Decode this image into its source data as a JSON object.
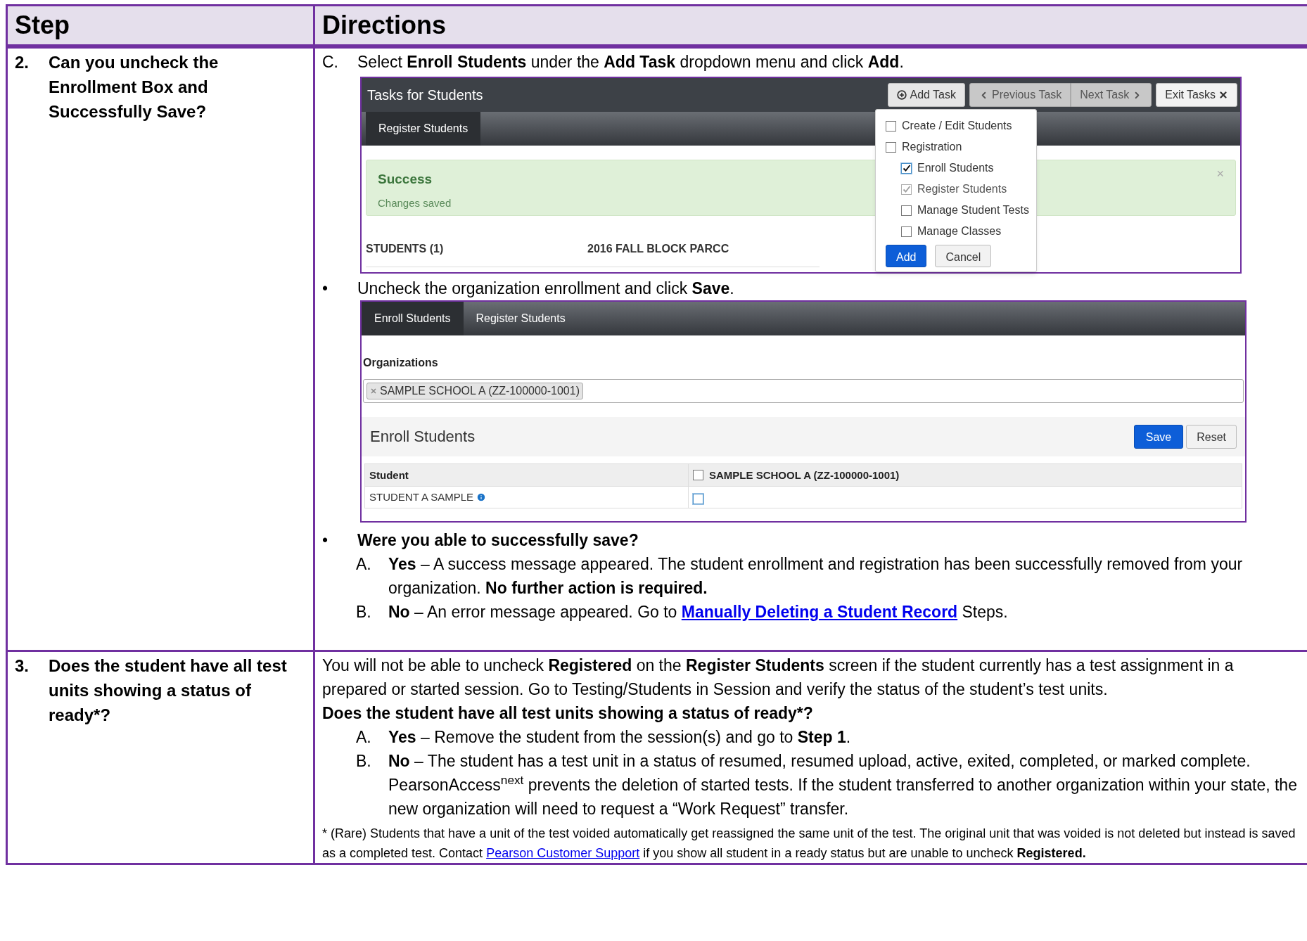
{
  "table": {
    "columns": [
      "Step",
      "Directions"
    ],
    "rows": [
      {
        "number": "2.",
        "question": "Can you uncheck the Enrollment Box and Successfully Save?",
        "directions": [
          {
            "kind": "lettered",
            "marker": "C.",
            "text": "Select **Enroll Students** under the **Add Task** dropdown menu and click **Add**."
          },
          {
            "kind": "tasks_screenshot",
            "title": "Tasks for Students",
            "add_task": "Add Task",
            "previous_task": "Previous Task",
            "next_task": "Next Task",
            "exit_tasks": "Exit Tasks",
            "tab": "Register Students",
            "alert_title": "Success",
            "alert_message": "Changes saved",
            "alert_close": "×",
            "column_1": "STUDENTS (1)",
            "column_2": "2016 FALL BLOCK PARCC",
            "dropdown": {
              "items": [
                {
                  "label": "Create / Edit Students",
                  "checked": false,
                  "disabled": false
                },
                {
                  "label": "Registration",
                  "checked": false,
                  "disabled": false,
                  "children": [
                    {
                      "label": "Enroll Students",
                      "checked": true,
                      "disabled": false
                    },
                    {
                      "label": "Register Students",
                      "checked": true,
                      "disabled": true
                    },
                    {
                      "label": "Manage Student Tests",
                      "checked": false,
                      "disabled": false
                    },
                    {
                      "label": "Manage Classes",
                      "checked": false,
                      "disabled": false
                    }
                  ]
                }
              ],
              "buttons": [
                "Add",
                "Cancel"
              ]
            }
          },
          {
            "kind": "bullet",
            "marker": "•",
            "text": "Uncheck the organization enrollment and click **Save**."
          },
          {
            "kind": "enroll_screenshot",
            "tabs": [
              {
                "label": "Enroll Students",
                "selected": true
              },
              {
                "label": "Register Students",
                "selected": false
              }
            ],
            "organizations_label": "Organizations",
            "organization_tag": "SAMPLE SCHOOL A (ZZ-100000-1001)",
            "section_title": "Enroll Students",
            "save": "Save",
            "reset": "Reset",
            "student_header": "Student",
            "school_header": "SAMPLE SCHOOL A (ZZ-100000-1001)",
            "school_checked": false,
            "students": [
              {
                "name": "STUDENT A SAMPLE",
                "enrolled": false
              }
            ]
          },
          {
            "kind": "bullet_bold",
            "marker": "•",
            "text": "Were you able to successfully save?"
          },
          {
            "kind": "sub_lettered",
            "marker": "A.",
            "text": "**Yes** – A success message appeared. The student enrollment and registration has been successfully removed from your organization. **No further action is required.**"
          },
          {
            "kind": "sub_lettered_link",
            "marker": "B.",
            "text": "**No** – An error message appeared. Go to",
            "link": "Manually Deleting a Student Record",
            "after": "Steps."
          }
        ]
      },
      {
        "number": "3.",
        "question": "Does the student have all test units showing a status of ready*?",
        "directions": [
          {
            "kind": "paragraph",
            "text": "You will not be able to uncheck **Registered** on the **Register Students** screen if the student currently has a test assignment in a prepared or started session. Go to Testing/Students in Session and verify the status of the student’s test units."
          },
          {
            "kind": "heading",
            "text": "Does the student have all test units showing a status of ready*?"
          },
          {
            "kind": "sub_lettered",
            "marker": "A.",
            "text": "**Yes** – Remove the student from the session(s) and go to **Step 1**."
          },
          {
            "kind": "sub_lettered",
            "marker": "B.",
            "text": "**No** – The student has a test unit in a status of resumed, resumed upload, active, exited, completed, or marked complete. PearsonAccess$^{next}$ prevents the deletion of started tests. If the student transferred to another organization within your state, the new organization will need to request a “Work Request” transfer."
          },
          {
            "kind": "footnote_link",
            "text": "* (Rare) Students that have a unit of the test voided automatically get reassigned the same unit of the test. The original unit that was voided is not deleted but instead is saved as a completed test. Contact",
            "link": "Pearson Customer Support",
            "after": "if you show all student in a ready status but are unable to uncheck **Registered.**"
          }
        ]
      }
    ]
  }
}
